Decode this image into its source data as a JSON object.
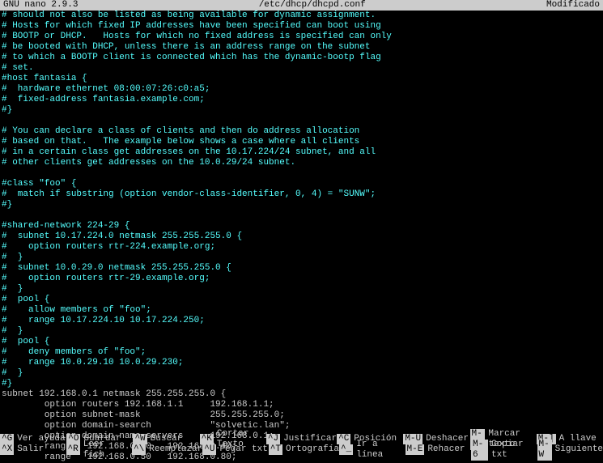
{
  "titlebar": {
    "app": "  GNU nano 2.9.3",
    "file": "/etc/dhcp/dhcpd.conf",
    "status": "Modificado"
  },
  "lines": [
    {
      "c": "cyan",
      "t": "# should not also be listed as being available for dynamic assignment."
    },
    {
      "c": "cyan",
      "t": "# Hosts for which fixed IP addresses have been specified can boot using"
    },
    {
      "c": "cyan",
      "t": "# BOOTP or DHCP.   Hosts for which no fixed address is specified can only"
    },
    {
      "c": "cyan",
      "t": "# be booted with DHCP, unless there is an address range on the subnet"
    },
    {
      "c": "cyan",
      "t": "# to which a BOOTP client is connected which has the dynamic-bootp flag"
    },
    {
      "c": "cyan",
      "t": "# set."
    },
    {
      "c": "cyan",
      "t": "#host fantasia {"
    },
    {
      "c": "cyan",
      "t": "#  hardware ethernet 08:00:07:26:c0:a5;"
    },
    {
      "c": "cyan",
      "t": "#  fixed-address fantasia.example.com;"
    },
    {
      "c": "cyan",
      "t": "#}"
    },
    {
      "c": "cyan",
      "t": ""
    },
    {
      "c": "cyan",
      "t": "# You can declare a class of clients and then do address allocation"
    },
    {
      "c": "cyan",
      "t": "# based on that.   The example below shows a case where all clients"
    },
    {
      "c": "cyan",
      "t": "# in a certain class get addresses on the 10.17.224/24 subnet, and all"
    },
    {
      "c": "cyan",
      "t": "# other clients get addresses on the 10.0.29/24 subnet."
    },
    {
      "c": "cyan",
      "t": ""
    },
    {
      "c": "cyan",
      "t": "#class \"foo\" {"
    },
    {
      "c": "cyan",
      "t": "#  match if substring (option vendor-class-identifier, 0, 4) = \"SUNW\";"
    },
    {
      "c": "cyan",
      "t": "#}"
    },
    {
      "c": "cyan",
      "t": ""
    },
    {
      "c": "cyan",
      "t": "#shared-network 224-29 {"
    },
    {
      "c": "cyan",
      "t": "#  subnet 10.17.224.0 netmask 255.255.255.0 {"
    },
    {
      "c": "cyan",
      "t": "#    option routers rtr-224.example.org;"
    },
    {
      "c": "cyan",
      "t": "#  }"
    },
    {
      "c": "cyan",
      "t": "#  subnet 10.0.29.0 netmask 255.255.255.0 {"
    },
    {
      "c": "cyan",
      "t": "#    option routers rtr-29.example.org;"
    },
    {
      "c": "cyan",
      "t": "#  }"
    },
    {
      "c": "cyan",
      "t": "#  pool {"
    },
    {
      "c": "cyan",
      "t": "#    allow members of \"foo\";"
    },
    {
      "c": "cyan",
      "t": "#    range 10.17.224.10 10.17.224.250;"
    },
    {
      "c": "cyan",
      "t": "#  }"
    },
    {
      "c": "cyan",
      "t": "#  pool {"
    },
    {
      "c": "cyan",
      "t": "#    deny members of \"foo\";"
    },
    {
      "c": "cyan",
      "t": "#    range 10.0.29.10 10.0.29.230;"
    },
    {
      "c": "cyan",
      "t": "#  }"
    },
    {
      "c": "cyan",
      "t": "#}"
    },
    {
      "c": "white",
      "t": "subnet 192.168.0.1 netmask 255.255.255.0 {"
    },
    {
      "c": "white",
      "t": "        option routers 192.168.1.1     192.168.1.1;"
    },
    {
      "c": "white",
      "t": "        option subnet-mask             255.255.255.0;"
    },
    {
      "c": "white",
      "t": "        option domain-search           \"solvetic.lan\";"
    },
    {
      "c": "white",
      "t": "        option domain-name-servers     192.168.0.1;"
    },
    {
      "c": "white",
      "t": "        range   192.168.0.20   192.168.0.40;"
    },
    {
      "c": "white",
      "t": "        range   192.168.0.50   192.168.0.80;"
    }
  ],
  "footer": {
    "row1": [
      {
        "key": "^G",
        "label": "Ver ayuda"
      },
      {
        "key": "^O",
        "label": "Guardar"
      },
      {
        "key": "^W",
        "label": "Buscar"
      },
      {
        "key": "^K",
        "label": "Cortar Texto"
      },
      {
        "key": "^J",
        "label": "Justificar"
      },
      {
        "key": "^C",
        "label": "Posición"
      },
      {
        "key": "M-U",
        "label": "Deshacer"
      },
      {
        "key": "M-A",
        "label": "Marcar texto"
      },
      {
        "key": "M-]",
        "label": "A llave"
      }
    ],
    "row2": [
      {
        "key": "^X",
        "label": "Salir"
      },
      {
        "key": "^R",
        "label": "Leer fich."
      },
      {
        "key": "^\\",
        "label": "Reemplazar"
      },
      {
        "key": "^U",
        "label": "Pegar txt"
      },
      {
        "key": "^T",
        "label": "Ortografía"
      },
      {
        "key": "^_",
        "label": "Ir a línea"
      },
      {
        "key": "M-E",
        "label": "Rehacer"
      },
      {
        "key": "M-6",
        "label": "Copiar txt"
      },
      {
        "key": "M-W",
        "label": "Siguiente"
      }
    ]
  }
}
